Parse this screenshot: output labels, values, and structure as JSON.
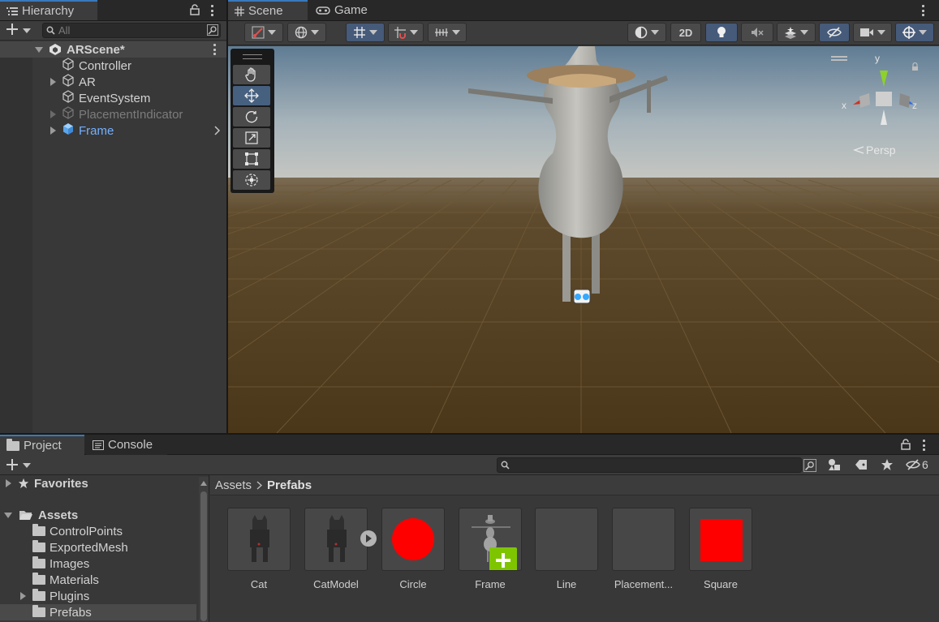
{
  "hierarchy": {
    "tab_label": "Hierarchy",
    "search_placeholder": "All",
    "scene_name": "ARScene*",
    "items": [
      {
        "label": "Controller"
      },
      {
        "label": "AR"
      },
      {
        "label": "EventSystem"
      },
      {
        "label": "PlacementIndicator"
      },
      {
        "label": "Frame"
      }
    ]
  },
  "scene_view": {
    "tab_scene": "Scene",
    "tab_game": "Game",
    "btn_2d": "2D",
    "gizmo_persp": "Persp",
    "gizmo_axes": {
      "x": "x",
      "y": "y",
      "z": "z"
    }
  },
  "project": {
    "tab_project": "Project",
    "tab_console": "Console",
    "hidden_count": "6",
    "breadcrumb_root": "Assets",
    "breadcrumb_current": "Prefabs",
    "favorites_label": "Favorites",
    "assets_label": "Assets",
    "folders": [
      {
        "label": "ControlPoints"
      },
      {
        "label": "ExportedMesh"
      },
      {
        "label": "Images"
      },
      {
        "label": "Materials"
      },
      {
        "label": "Plugins"
      },
      {
        "label": "Prefabs"
      }
    ],
    "assets": [
      {
        "label": "Cat"
      },
      {
        "label": "CatModel"
      },
      {
        "label": "Circle"
      },
      {
        "label": "Frame"
      },
      {
        "label": "Line"
      },
      {
        "label": "Placement..."
      },
      {
        "label": "Square"
      }
    ]
  },
  "colors": {
    "accent_blue": "#3a79bb",
    "selection": "#2c5d87",
    "red_asset": "#ff0000",
    "green_plus": "#7ec500",
    "frame_blue": "#74b0ff"
  }
}
